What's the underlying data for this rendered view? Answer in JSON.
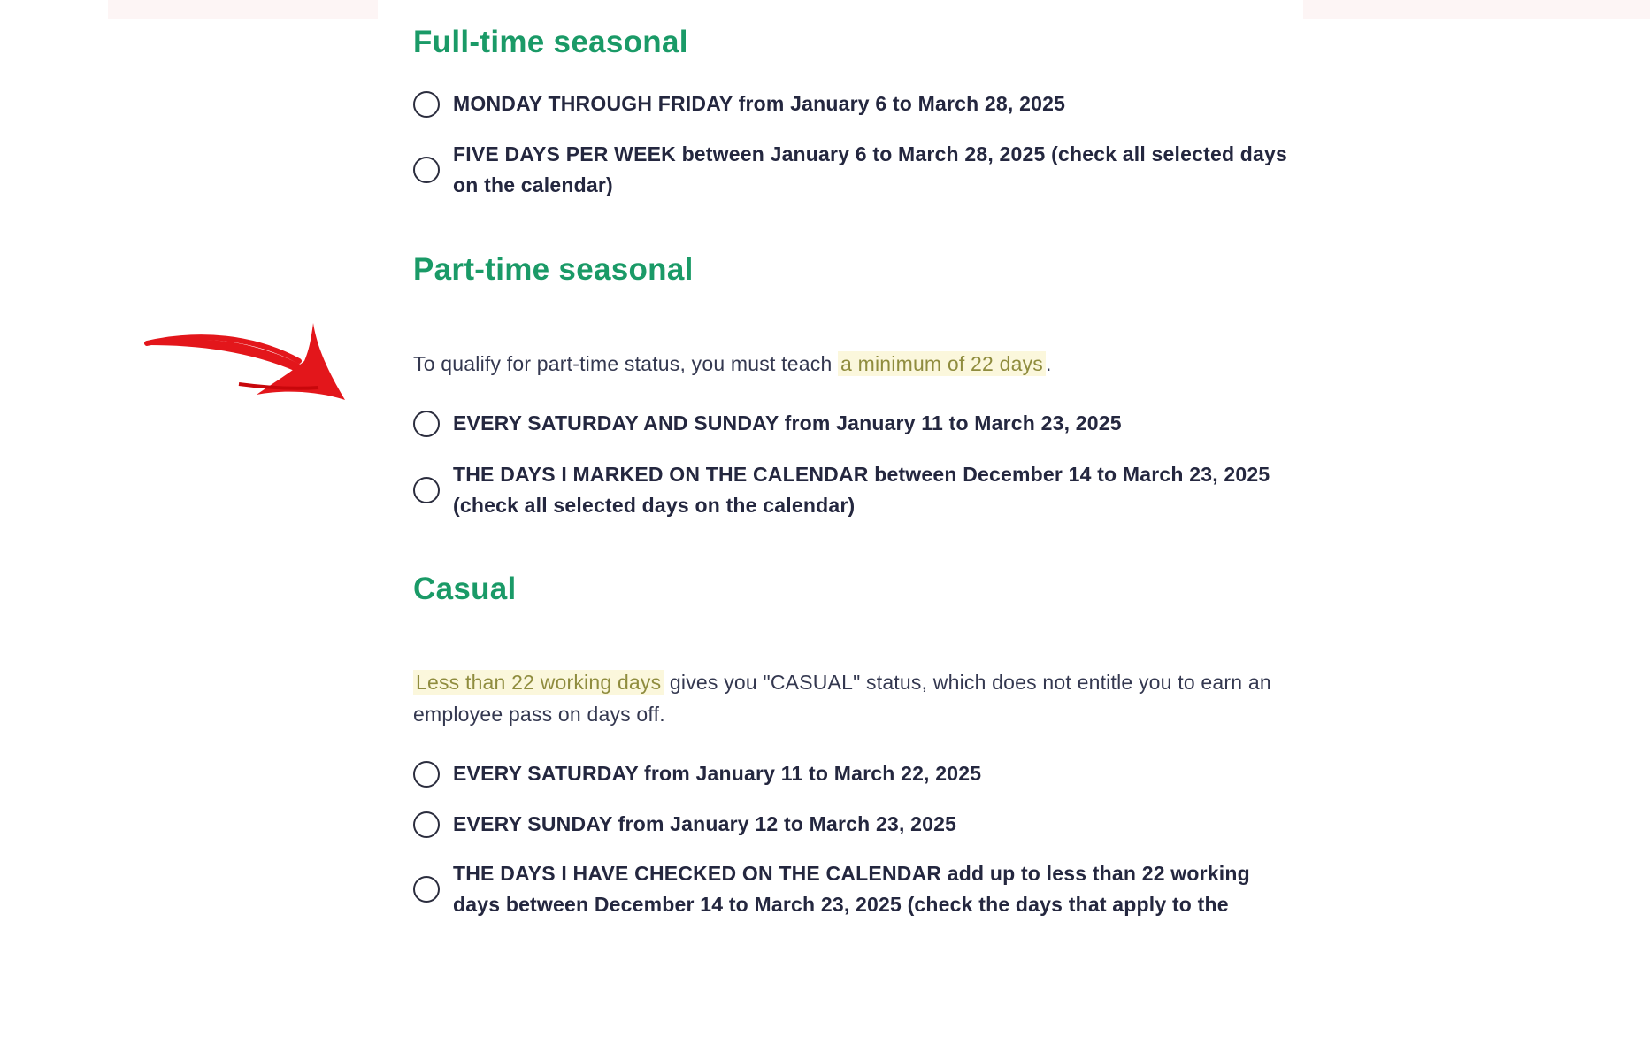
{
  "sections": {
    "full_time": {
      "title": "Full-time seasonal",
      "options": [
        {
          "label": "MONDAY THROUGH FRIDAY from January 6 to March 28, 2025"
        },
        {
          "label": "FIVE DAYS PER WEEK between January 6 to March 28, 2025 (check all selected days on the calendar)"
        }
      ]
    },
    "part_time": {
      "title": "Part-time seasonal",
      "intro_text": "To qualify for part-time status, you must teach ",
      "intro_highlight": "a minimum of 22 days",
      "intro_end": ".",
      "options": [
        {
          "label": "EVERY SATURDAY AND SUNDAY from January 11 to March 23, 2025"
        },
        {
          "label": "THE DAYS I MARKED ON THE CALENDAR between December 14 to March 23, 2025 (check all selected days on the calendar)"
        }
      ]
    },
    "casual": {
      "title": "Casual",
      "intro_highlight": "Less than 22 working days",
      "intro_text": " gives you \"CASUAL\" status, which does not entitle you to earn an employee pass on days off.",
      "options": [
        {
          "label": "EVERY SATURDAY from January 11 to March 22, 2025"
        },
        {
          "label": "EVERY SUNDAY from January 12 to March 23, 2025"
        },
        {
          "label": "THE DAYS I HAVE CHECKED ON THE CALENDAR add up to less than 22 working days between December 14 to March 23, 2025 (check the days that apply to the"
        }
      ]
    }
  },
  "annotation": {
    "arrow_color": "#e3161b",
    "icon": "red-arrow-icon"
  }
}
